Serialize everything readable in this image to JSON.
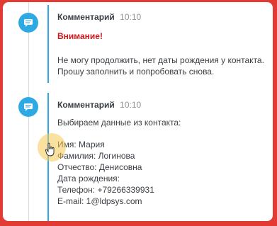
{
  "entries": [
    {
      "author": "Комментарий",
      "time": "10:10",
      "warning": "Внимание!",
      "lines": [
        "Не могу продолжить, нет даты рождения у контакта.",
        "Прошу заполнить и попробовать снова."
      ]
    },
    {
      "author": "Комментарий",
      "time": "10:10",
      "intro": "Выбираем данные из контакта:",
      "lines": [
        "Имя: Мария",
        "Фамилия: Логинова",
        "Отчество: Денисовна",
        "Дата рождения:",
        "Телефон: +79266339931",
        "E-mail: 1@ldpsys.com"
      ]
    }
  ],
  "colors": {
    "accent": "#2fa9e4",
    "warning": "#d0161b",
    "frame": "#e23b33"
  },
  "icons": {
    "comment": "comment-bubble-icon",
    "cursor": "hand-pointer-icon"
  }
}
